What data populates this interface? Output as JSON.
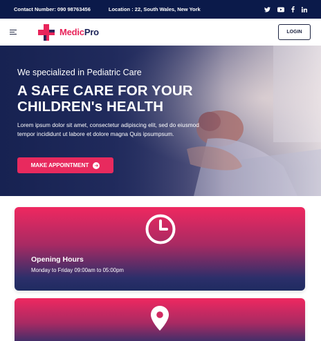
{
  "topbar": {
    "contact": "Contact Number: 090 98763456",
    "location": "Location : 22, South Wales, New York",
    "social": [
      "twitter-icon",
      "youtube-icon",
      "facebook-icon",
      "linkedin-icon"
    ]
  },
  "header": {
    "logo_part1": "Medic",
    "logo_part2": "Pro",
    "login_label": "LOGIN"
  },
  "hero": {
    "subtitle": "We specialized in Pediatric Care",
    "title_line1": "A SAFE CARE FOR YOUR",
    "title_line2": "CHILDREN's HEALTH",
    "description": "Lorem ipsum dolor sit amet, consectetur adipiscing elit, sed do eiusmod tempor incididunt ut labore et dolore magna Quis ipsumpsum.",
    "button_label": "MAKE APPOINTMENT"
  },
  "cards": [
    {
      "icon": "clock-icon",
      "title": "Opening Hours",
      "text": "Monday to Friday 09:00am to 05:00pm"
    },
    {
      "icon": "location-pin-icon",
      "title": "",
      "text": ""
    }
  ],
  "colors": {
    "accent": "#e82a5e",
    "navy": "#0b1a4a"
  }
}
